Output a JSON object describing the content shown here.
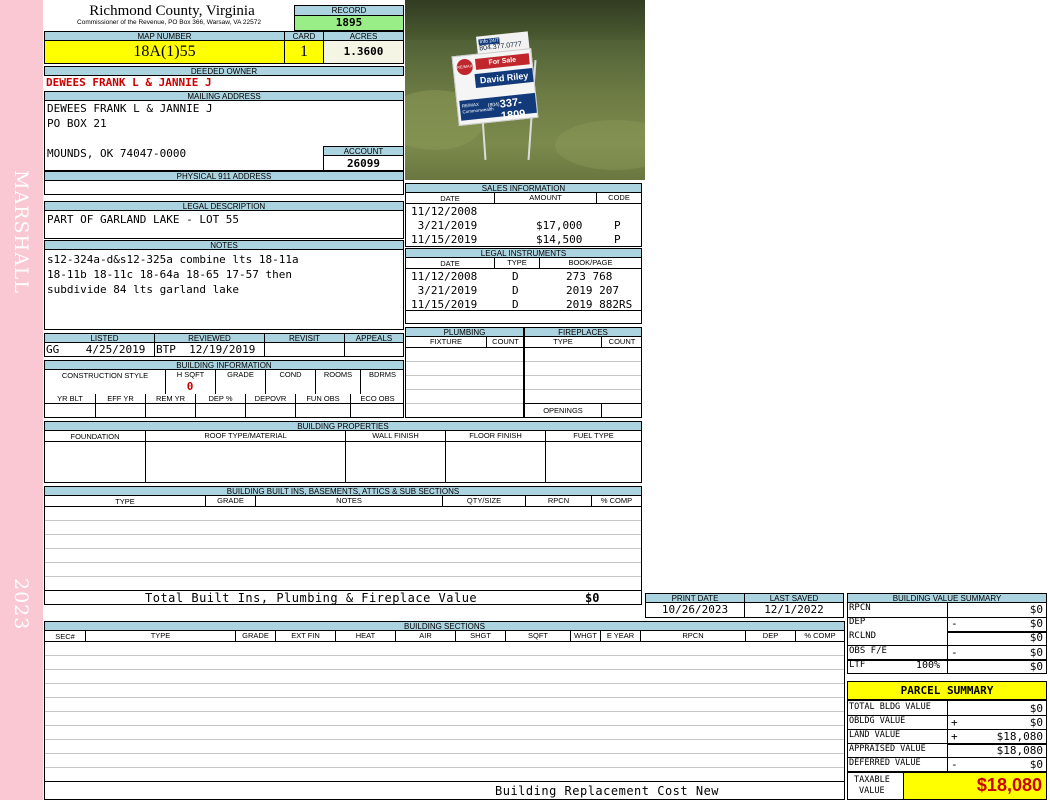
{
  "sidebar": {
    "district": "MARSHALL",
    "year": "2023"
  },
  "header": {
    "county": "Richmond County, Virginia",
    "commissioner": "Commissioner of the Revenue, PO Box 366, Warsaw, VA 22572",
    "record_label": "RECORD",
    "record": "1895"
  },
  "parcel": {
    "map_label": "MAP NUMBER",
    "map_number": "18A(1)55",
    "card_label": "CARD",
    "card": "1",
    "acres_label": "ACRES",
    "acres": "1.3600"
  },
  "owner": {
    "deeded_label": "DEEDED OWNER",
    "deeded_owner": "DEWEES FRANK L & JANNIE J",
    "mailing_label": "MAILING ADDRESS",
    "mail_line1": "DEWEES FRANK L & JANNIE J",
    "mail_line2": "PO BOX 21",
    "mail_line3": "MOUNDS, OK 74047-0000",
    "account_label": "ACCOUNT",
    "account": "26099",
    "physical_label": "PHYSICAL 911 ADDRESS"
  },
  "legal": {
    "label": "LEGAL DESCRIPTION",
    "text": "PART OF GARLAND LAKE - LOT 55"
  },
  "notes": {
    "label": "NOTES",
    "line1": "s12-324a-d&s12-325a combine lts 18-11a",
    "line2": "18-11b 18-11c 18-64a 18-65 17-57 then",
    "line3": "subdivide 84 lts garland lake"
  },
  "photo": {
    "sign_phone": "804.377.0777",
    "sign_info": "Info 24/7",
    "sign_sale": "For Sale",
    "sign_brand": "RE/MAX",
    "sign_agent": "David Riley",
    "sign_office": "RE/MAX Commonwealth",
    "sign_number": "337-1809",
    "sign_area": "(804)"
  },
  "sales": {
    "label": "SALES INFORMATION",
    "col_date": "DATE",
    "col_amount": "AMOUNT",
    "col_code": "CODE",
    "rows": [
      {
        "date": "11/12/2008",
        "amount": "",
        "code": ""
      },
      {
        "date": " 3/21/2019",
        "amount": "$17,000",
        "code": "P"
      },
      {
        "date": "11/15/2019",
        "amount": "$14,500",
        "code": "P"
      }
    ]
  },
  "instruments": {
    "label": "LEGAL INSTRUMENTS",
    "col_date": "DATE",
    "col_type": "TYPE",
    "col_book": "BOOK/PAGE",
    "rows": [
      {
        "date": "11/12/2008",
        "type": "D",
        "book": "273 768"
      },
      {
        "date": " 3/21/2019",
        "type": "D",
        "book": "2019 207"
      },
      {
        "date": "11/15/2019",
        "type": "D",
        "book": "2019 882RS"
      }
    ]
  },
  "review": {
    "listed_label": "LISTED",
    "reviewed_label": "REVIEWED",
    "revisit_label": "REVISIT",
    "appeals_label": "APPEALS",
    "listed": "GG    4/25/2019",
    "reviewed": "BTP  12/19/2019"
  },
  "building_info": {
    "label": "BUILDING INFORMATION",
    "construction": "CONSTRUCTION STYLE",
    "hsqft": "H SQFT",
    "grade": "GRADE",
    "cond": "COND",
    "rooms": "ROOMS",
    "bdrms": "BDRMS",
    "hsqft_value": "0",
    "yrblt": "YR BLT",
    "effyr": "EFF YR",
    "remyr": "REM YR",
    "dep": "DEP %",
    "depovr": "DEPOVR",
    "funobs": "FUN OBS",
    "ecoobs": "ECO OBS"
  },
  "plumbing": {
    "label": "PLUMBING",
    "fixture": "FIXTURE",
    "count": "COUNT"
  },
  "fireplaces": {
    "label": "FIREPLACES",
    "type": "TYPE",
    "count": "COUNT",
    "openings": "OPENINGS"
  },
  "properties": {
    "label": "BUILDING PROPERTIES",
    "foundation": "FOUNDATION",
    "roof": "ROOF TYPE/MATERIAL",
    "wall": "WALL FINISH",
    "floor": "FLOOR FINISH",
    "fuel": "FUEL TYPE"
  },
  "builtins": {
    "label": "BUILDING BUILT INS, BASEMENTS, ATTICS & SUB SECTIONS",
    "type": "TYPE",
    "grade": "GRADE",
    "notes": "NOTES",
    "qty": "QTY/SIZE",
    "rpcn": "RPCN",
    "pcomp": "% COMP",
    "total_label": "Total Built Ins, Plumbing & Fireplace Value",
    "total_value": "$0"
  },
  "dates": {
    "print_label": "PRINT DATE",
    "print_date": "10/26/2023",
    "saved_label": "LAST SAVED",
    "saved_date": "12/1/2022"
  },
  "sections": {
    "label": "BUILDING SECTIONS",
    "sec": "SEC#",
    "type": "TYPE",
    "grade": "GRADE",
    "extfin": "EXT FIN",
    "heat": "HEAT",
    "air": "AIR",
    "shgt": "SHGT",
    "sqft": "SQFT",
    "whgt": "WHGT",
    "eyear": "E YEAR",
    "rpcn": "RPCN",
    "dep": "DEP",
    "pcomp": "% COMP",
    "footer": "Building Replacement Cost New"
  },
  "bvs": {
    "label": "BUILDING VALUE SUMMARY",
    "rows": [
      {
        "label": "RPCN",
        "sign": "",
        "value": "$0"
      },
      {
        "label": "DEP",
        "sign": "-",
        "value": "$0"
      },
      {
        "label": "RCLND",
        "sign": "",
        "value": "$0"
      },
      {
        "label": "OBS F/E",
        "sign": "-",
        "value": "$0"
      },
      {
        "label": "LTF",
        "sign": "100%",
        "value": "$0"
      }
    ]
  },
  "summary": {
    "label": "PARCEL SUMMARY",
    "rows": [
      {
        "label": "TOTAL BLDG VALUE",
        "sign": "",
        "value": "$0"
      },
      {
        "label": "OBLDG VALUE",
        "sign": "+",
        "value": "$0"
      },
      {
        "label": "LAND VALUE",
        "sign": "+",
        "value": "$18,080"
      },
      {
        "label": "APPRAISED VALUE",
        "sign": "",
        "value": "$18,080"
      },
      {
        "label": "DEFERRED VALUE",
        "sign": "-",
        "value": "$0"
      }
    ],
    "taxable_label1": "TAXABLE",
    "taxable_label2": "VALUE",
    "taxable_value": "$18,080"
  },
  "colors": {
    "sidebar": "#f9c8d2",
    "header": "#acd3e0",
    "highlight": "#ffff00",
    "record": "#99ee88",
    "owner": "#cc0000"
  }
}
